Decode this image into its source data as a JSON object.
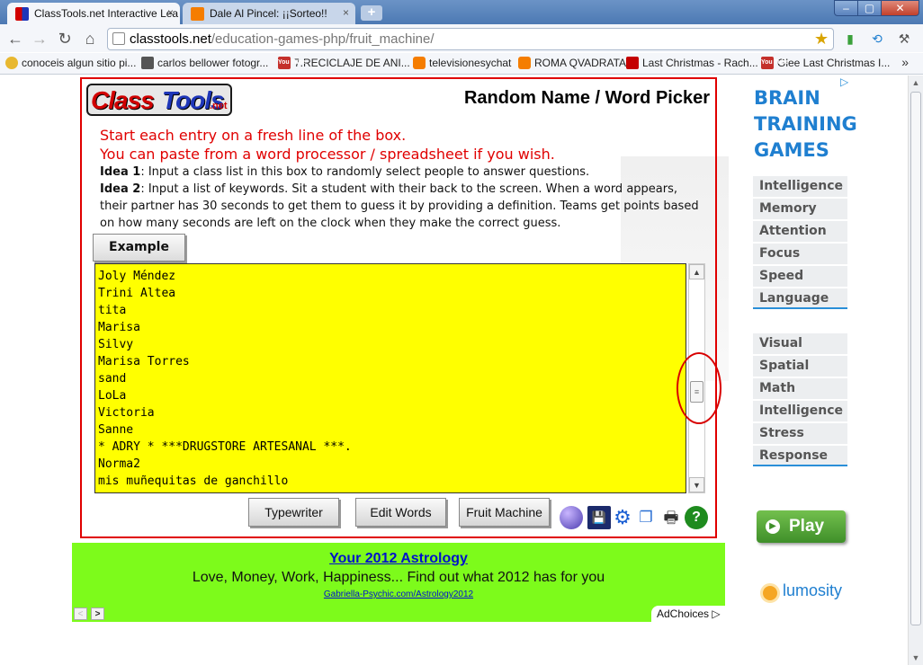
{
  "browser": {
    "tabs": [
      {
        "title": "ClassTools.net Interactive Lea",
        "active": true
      },
      {
        "title": "Dale Al Pincel: ¡¡Sorteo!!",
        "active": false
      }
    ],
    "close_glyph": "×",
    "newtab_glyph": "+",
    "window_controls": {
      "min": "–",
      "max": "▢",
      "close": "✕"
    },
    "nav": {
      "back": "←",
      "forward": "→",
      "reload": "↻",
      "home": "⌂"
    },
    "url_host": "classtools.net",
    "url_path": "/education-games-php/fruit_machine/",
    "star_glyph": "★",
    "bookmarks": [
      {
        "label": "conoceis algun sitio pi...",
        "icon": "glob"
      },
      {
        "label": "carlos bellower fotogr...",
        "icon": "ph"
      },
      {
        "label": "7.RECICLAJE DE ANI...",
        "icon": "yt"
      },
      {
        "label": "televisionesychat",
        "icon": "bl"
      },
      {
        "label": "ROMA QVADRATA",
        "icon": "bl"
      },
      {
        "label": "Last Christmas - Rach...",
        "icon": "red"
      },
      {
        "label": "Glee Last Christmas I...",
        "icon": "yt"
      }
    ],
    "more_glyph": "»",
    "yt_text": "You Tube"
  },
  "app": {
    "logo_part1": "Class",
    "logo_part2": "Tools",
    "logo_part3": ".net",
    "title": "Random Name / Word Picker",
    "instructions": {
      "line1": "Start each entry on a fresh line of the box.",
      "line2": "You can paste from a word processor / spreadsheet if you wish.",
      "idea1_label": "Idea 1",
      "idea1_text": ": Input a class list in this box to randomly select people to answer questions.",
      "idea2_label": "Idea 2",
      "idea2_text": ": Input a list of keywords. Sit a student with their back to the screen. When a word appears, their partner has 30 seconds to get them to guess it by providing a definition. Teams get points based on how many seconds are left on the clock when they make the correct guess."
    },
    "example_label": "Example",
    "words": [
      "Joly Méndez",
      "Trini Altea",
      "tita",
      "Marisa",
      "Silvy",
      "Marisa Torres",
      "sand",
      "LoLa",
      "Victoria",
      "Sanne",
      "* ADRY * ***DRUGSTORE ARTESANAL ***.",
      "Norma2",
      "mis muñequitas de ganchillo"
    ],
    "buttons": {
      "typewriter": "Typewriter",
      "edit_words": "Edit Words",
      "fruit_machine": "Fruit Machine"
    },
    "tool_glyphs": {
      "save": "💾",
      "gear": "⚙",
      "window": "❐",
      "print": "🖶",
      "help": "?"
    }
  },
  "right_ad": {
    "adchoices_glyph": "▷",
    "heading_lines": [
      "BRAIN",
      "TRAINING",
      "GAMES"
    ],
    "group1": [
      "Intelligence",
      "Memory",
      "Attention",
      "Focus",
      "Speed",
      "Language"
    ],
    "group2": [
      "Visual",
      "Spatial",
      "Math",
      "Intelligence",
      "Stress",
      "Response"
    ],
    "play_label": "Play",
    "play_glyph": "▶",
    "brand": "lumosity"
  },
  "bottom_ad": {
    "title": "Your 2012 Astrology",
    "description": "Love, Money, Work, Happiness... Find out what 2012 has for you",
    "url": "Gabriella-Psychic.com/Astrology2012",
    "adchoices": "AdChoices",
    "prev_glyph": "<",
    "next_glyph": ">"
  },
  "colors": {
    "accent_red": "#e00000",
    "word_box": "#ffff00",
    "ad_green": "#7dfb1b",
    "brain_blue": "#1f7fd0"
  }
}
